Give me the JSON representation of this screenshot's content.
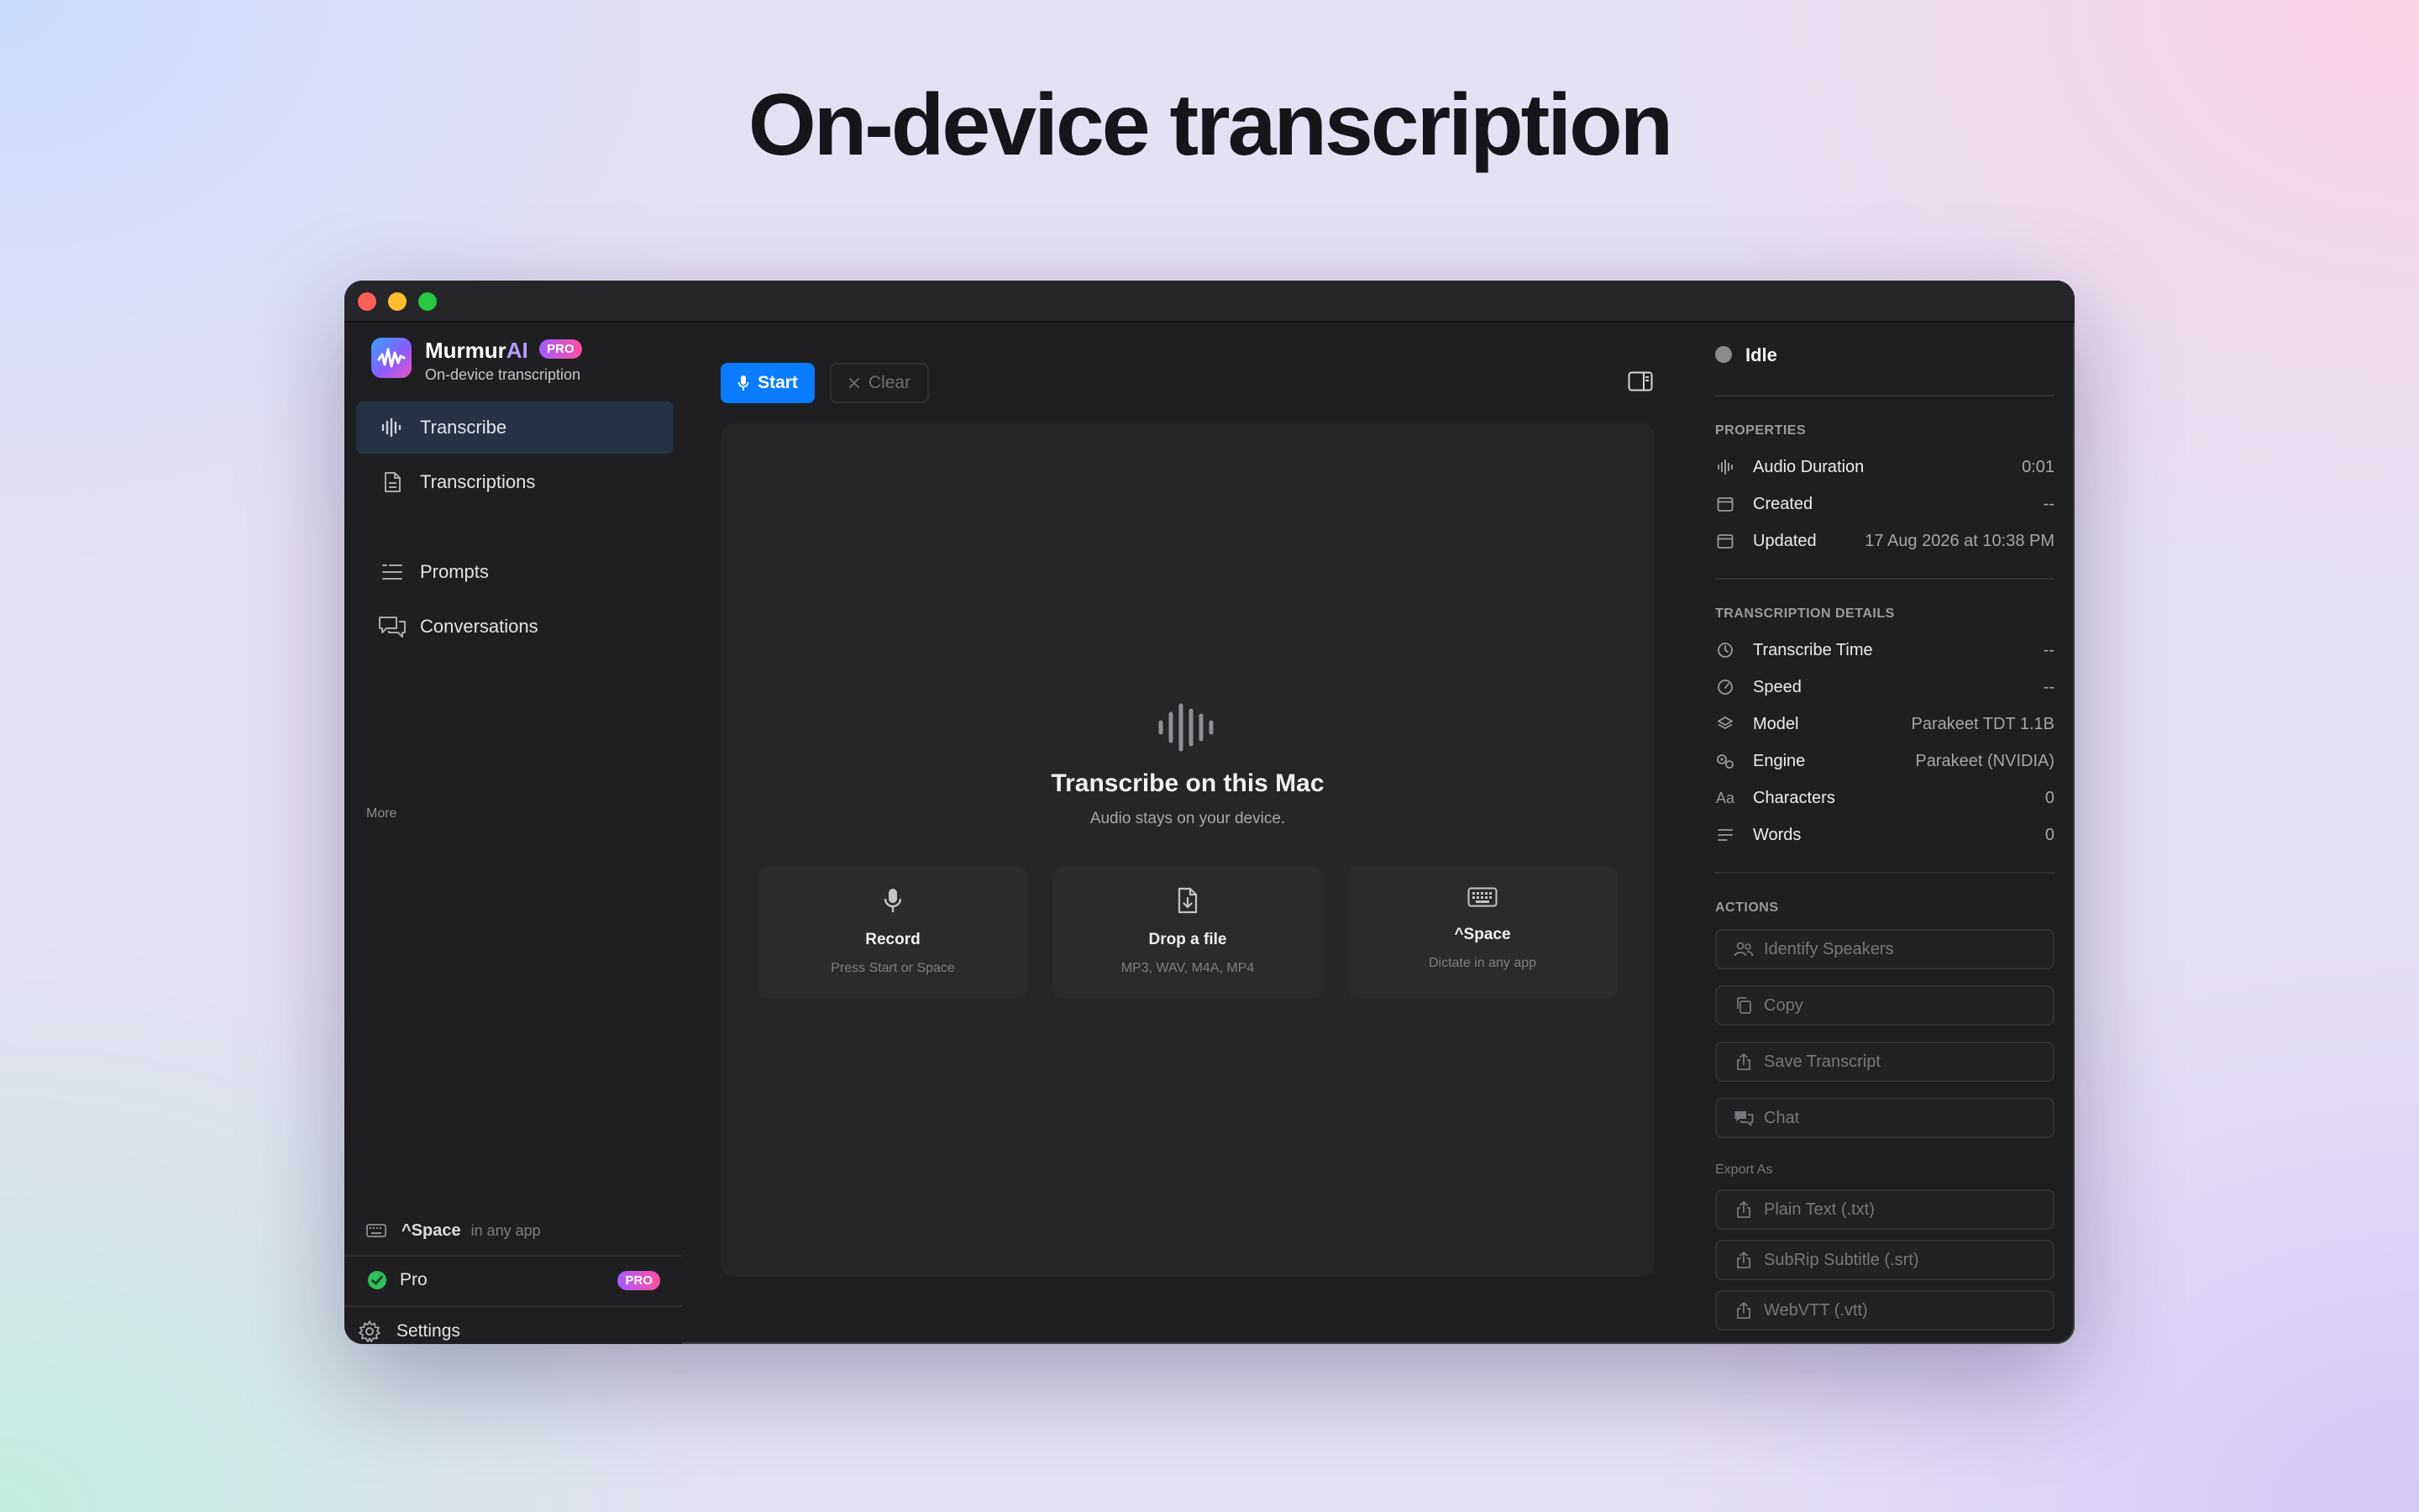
{
  "hero": {
    "title": "On-device transcription"
  },
  "app": {
    "name_main": "Murmur",
    "name_ai": "AI",
    "badge": "PRO",
    "subtitle": "On-device transcription"
  },
  "sidebar": {
    "items": [
      {
        "label": "Transcribe",
        "icon": "waveform-icon",
        "active": true
      },
      {
        "label": "Transcriptions",
        "icon": "document-icon",
        "active": false
      }
    ],
    "more_label": "More",
    "more_items": [
      {
        "label": "Prompts",
        "icon": "prompts-icon"
      },
      {
        "label": "Conversations",
        "icon": "chat-bubbles-icon"
      }
    ],
    "shortcut": {
      "key": "^Space",
      "hint": "in any app"
    },
    "plan": {
      "label": "Pro",
      "badge": "PRO"
    },
    "settings_label": "Settings"
  },
  "toolbar": {
    "start_label": "Start",
    "clear_label": "Clear"
  },
  "empty_state": {
    "title": "Transcribe on this Mac",
    "subtitle": "Audio stays on your device.",
    "cards": [
      {
        "title": "Record",
        "subtitle": "Press Start or Space",
        "icon": "microphone-icon"
      },
      {
        "title": "Drop a file",
        "subtitle": "MP3, WAV, M4A, MP4",
        "icon": "file-download-icon"
      },
      {
        "title": "^Space",
        "subtitle": "Dictate in any app",
        "icon": "keyboard-icon"
      }
    ]
  },
  "inspector": {
    "status": "Idle",
    "properties_heading": "PROPERTIES",
    "properties": [
      {
        "key": "Audio Duration",
        "value": "0:01"
      },
      {
        "key": "Created",
        "value": "--"
      },
      {
        "key": "Updated",
        "value": "17 Aug 2026 at 10:38 PM"
      }
    ],
    "details_heading": "TRANSCRIPTION DETAILS",
    "details": [
      {
        "key": "Transcribe Time",
        "value": "--"
      },
      {
        "key": "Speed",
        "value": "--"
      },
      {
        "key": "Model",
        "value": "Parakeet TDT 1.1B"
      },
      {
        "key": "Engine",
        "value": "Parakeet (NVIDIA)"
      },
      {
        "key": "Characters",
        "value": "0"
      },
      {
        "key": "Words",
        "value": "0"
      }
    ],
    "actions_heading": "ACTIONS",
    "actions": [
      {
        "label": "Identify Speakers"
      },
      {
        "label": "Copy"
      },
      {
        "label": "Save Transcript"
      },
      {
        "label": "Chat"
      }
    ],
    "export_label": "Export As",
    "exports": [
      {
        "label": "Plain Text (.txt)"
      },
      {
        "label": "SubRip Subtitle (.srt)"
      },
      {
        "label": "WebVTT (.vtt)"
      }
    ]
  },
  "colors": {
    "accent": "#0a7cff",
    "active_nav": "#253246",
    "pro_gradient_start": "#a45cff",
    "pro_gradient_end": "#ff4fa0",
    "status_dot": "#8a8a8f"
  }
}
